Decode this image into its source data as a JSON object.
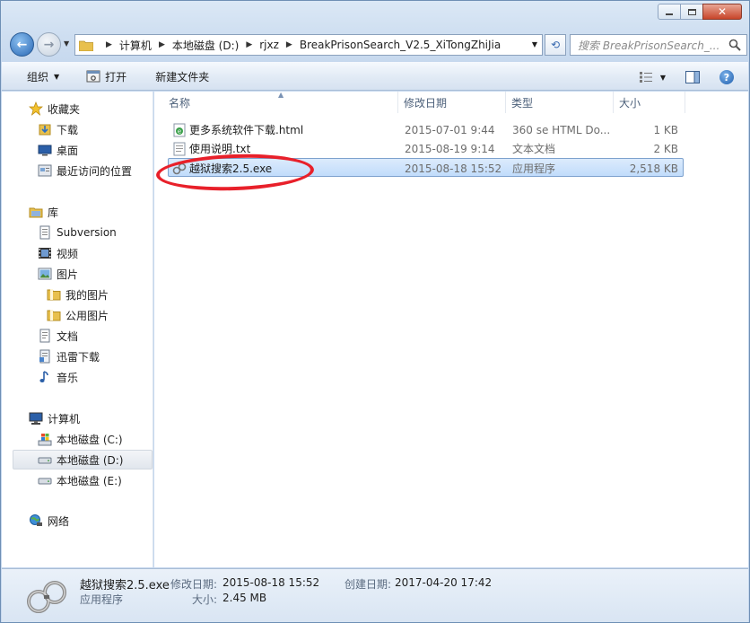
{
  "window": {
    "minimize": "–",
    "maximize": "□",
    "close": "✕"
  },
  "nav": {
    "breadcrumbs": [
      "计算机",
      "本地磁盘 (D:)",
      "rjxz",
      "BreakPrisonSearch_V2.5_XiTongZhiJia"
    ],
    "search_placeholder": "搜索 BreakPrisonSearch_..."
  },
  "toolbar": {
    "organize": "组织",
    "open": "打开",
    "new_folder": "新建文件夹"
  },
  "sidebar": {
    "favorites": {
      "label": "收藏夹",
      "items": [
        "下载",
        "桌面",
        "最近访问的位置"
      ]
    },
    "libraries": {
      "label": "库",
      "items": [
        "Subversion",
        "视频",
        "图片",
        "我的图片",
        "公用图片",
        "文档",
        "迅雷下载",
        "音乐"
      ]
    },
    "computer": {
      "label": "计算机",
      "items": [
        "本地磁盘 (C:)",
        "本地磁盘 (D:)",
        "本地磁盘 (E:)"
      ]
    },
    "network": {
      "label": "网络"
    }
  },
  "columns": [
    "名称",
    "修改日期",
    "类型",
    "大小"
  ],
  "files": [
    {
      "name": "更多系统软件下载.html",
      "modified": "2015-07-01 9:44",
      "type": "360 se HTML Do...",
      "size": "1 KB",
      "icon": "html-file-icon"
    },
    {
      "name": "使用说明.txt",
      "modified": "2015-08-19 9:14",
      "type": "文本文档",
      "size": "2 KB",
      "icon": "text-file-icon"
    },
    {
      "name": "越狱搜索2.5.exe",
      "modified": "2015-08-18 15:52",
      "type": "应用程序",
      "size": "2,518 KB",
      "icon": "handcuffs-app-icon",
      "selected": true
    }
  ],
  "details": {
    "name": "越狱搜索2.5.exe",
    "type": "应用程序",
    "modified_label": "修改日期:",
    "modified": "2015-08-18 15:52",
    "created_label": "创建日期:",
    "created": "2017-04-20 17:42",
    "size_label": "大小:",
    "size": "2.45 MB"
  },
  "colors": {
    "accent": "#3b6bb0",
    "selection": "#c1dcfb",
    "annotation": "#e8202a"
  }
}
